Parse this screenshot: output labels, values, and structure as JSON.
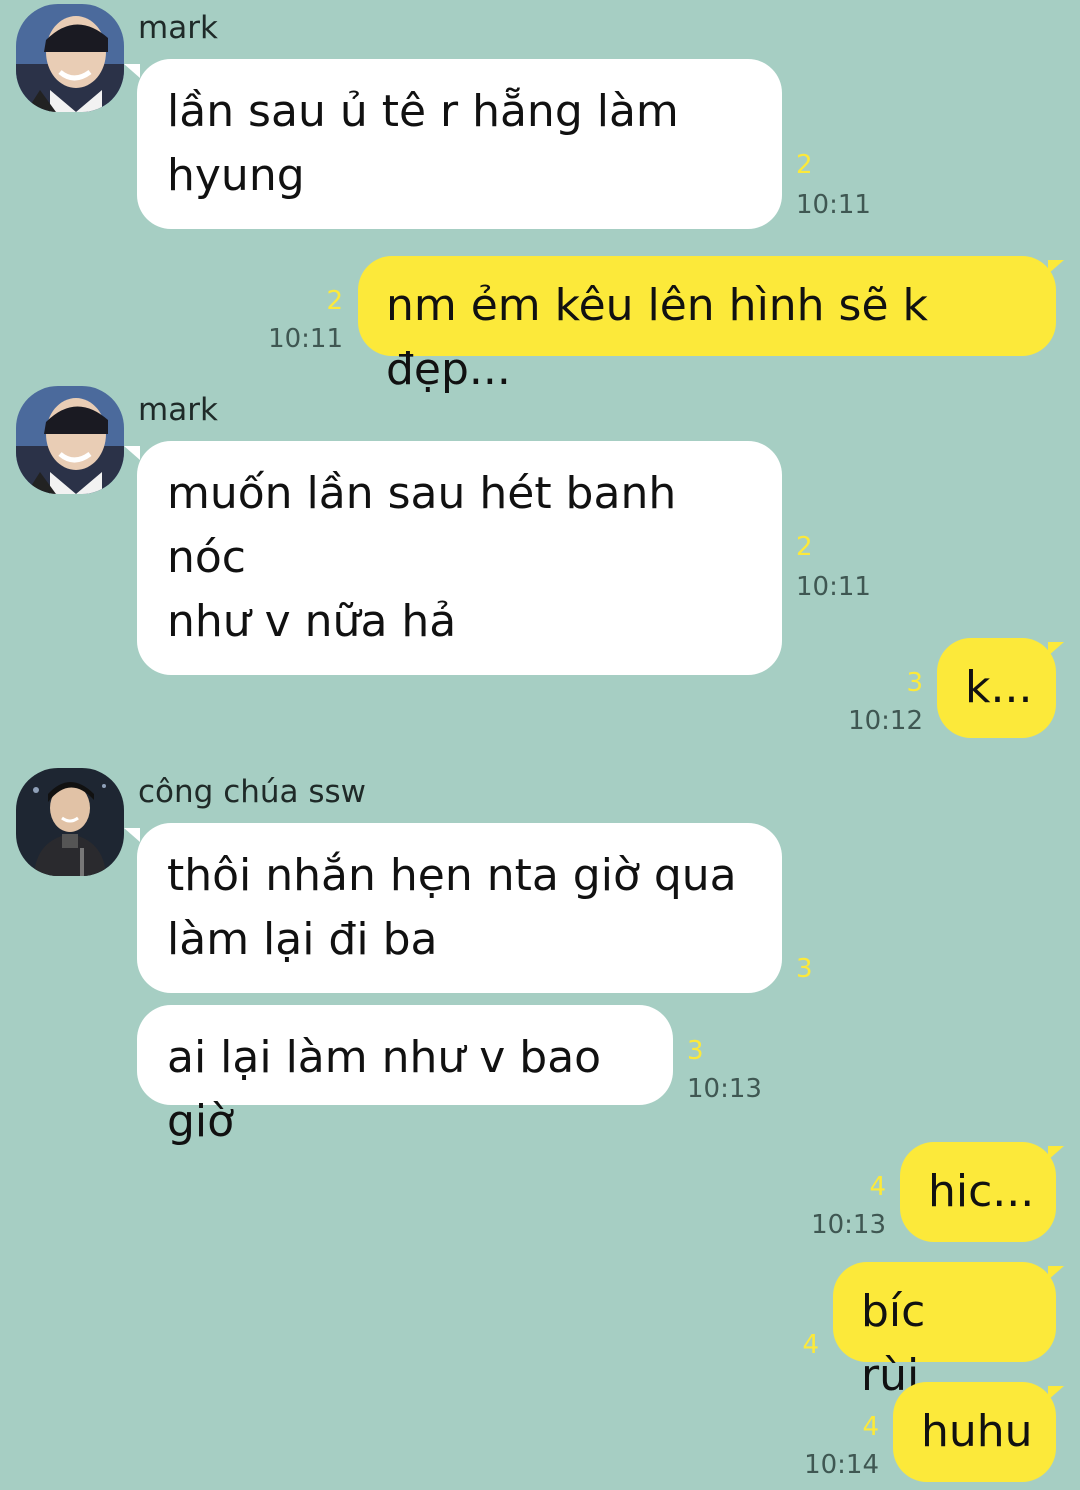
{
  "contacts": {
    "mark": {
      "name": "mark"
    },
    "ssw": {
      "name": "công chúa ssw"
    }
  },
  "messages": [
    {
      "from": "mark",
      "direction": "in",
      "text": "lần sau ủ tê r hẵng làm\nhyung",
      "unread": "2",
      "time": "10:11"
    },
    {
      "from": "me",
      "direction": "out",
      "text": "nm ẻm kêu lên hình sẽ k đẹp...",
      "unread": "2",
      "time": "10:11"
    },
    {
      "from": "mark",
      "direction": "in",
      "text": "muốn lần sau hét banh nóc\nnhư v nữa hả",
      "unread": "2",
      "time": "10:11"
    },
    {
      "from": "me",
      "direction": "out",
      "text": "k...",
      "unread": "3",
      "time": "10:12"
    },
    {
      "from": "công chúa ssw",
      "direction": "in",
      "text": "thôi nhắn hẹn nta giờ qua\nlàm lại đi ba",
      "unread": "3",
      "time": ""
    },
    {
      "from": "công chúa ssw",
      "direction": "in",
      "text": "ai lại làm như v bao giờ",
      "unread": "3",
      "time": "10:13"
    },
    {
      "from": "me",
      "direction": "out",
      "text": "hic...",
      "unread": "4",
      "time": "10:13"
    },
    {
      "from": "me",
      "direction": "out",
      "text": "bíc rùi...",
      "unread": "4",
      "time": ""
    },
    {
      "from": "me",
      "direction": "out",
      "text": "huhu",
      "unread": "4",
      "time": "10:14"
    }
  ],
  "colors": {
    "background": "#a6cec3",
    "incoming_bubble": "#ffffff",
    "outgoing_bubble": "#fce93a",
    "unread_count": "#fce93a",
    "timestamp": "#3f5752"
  }
}
